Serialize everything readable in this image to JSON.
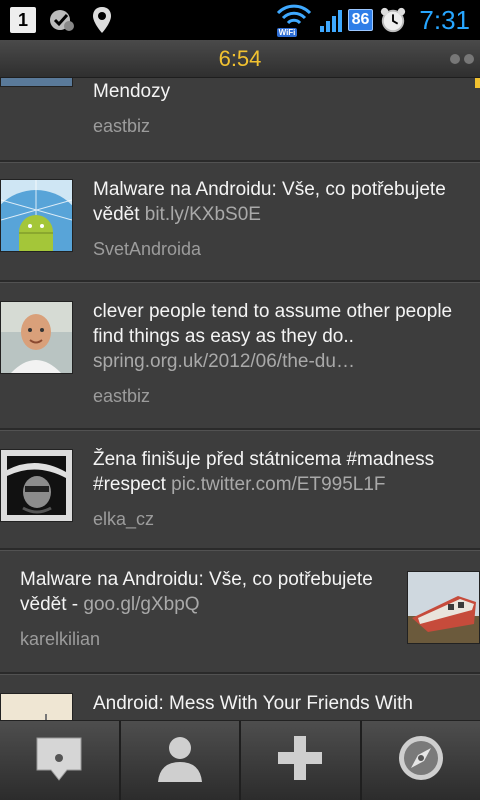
{
  "status_bar": {
    "notification_count": "1",
    "battery_level": "86",
    "wifi_label": "WiFi",
    "time": "7:31"
  },
  "header": {
    "time": "6:54"
  },
  "tweets": [
    {
      "text": "Mendozy",
      "link": "",
      "author": "eastbiz"
    },
    {
      "text": "Malware na Androidu: Vše, co potřebujete vědět",
      "link": "bit.ly/KXbS0E",
      "author": "SvetAndroida"
    },
    {
      "text": "clever people tend to assume other people find things as easy as they do..",
      "link": "spring.org.uk/2012/06/the-du…",
      "author": "eastbiz"
    },
    {
      "text": "Žena finišuje před státnicema #madness #respect",
      "link": "pic.twitter.com/ET995L1F",
      "author": "elka_cz"
    },
    {
      "text": "Malware na Androidu: Vše, co potřebujete vědět - ",
      "link": "goo.gl/gXbpQ",
      "author": "karelkilian"
    },
    {
      "text": "Android:  Mess With Your Friends With",
      "link": "",
      "author": ""
    }
  ],
  "toolbar": {
    "items": [
      "compose-icon",
      "profile-icon",
      "add-icon",
      "explore-icon"
    ]
  },
  "colors": {
    "accent": "#f2c230",
    "clock": "#27a6ff",
    "background": "#3d3d3d"
  }
}
